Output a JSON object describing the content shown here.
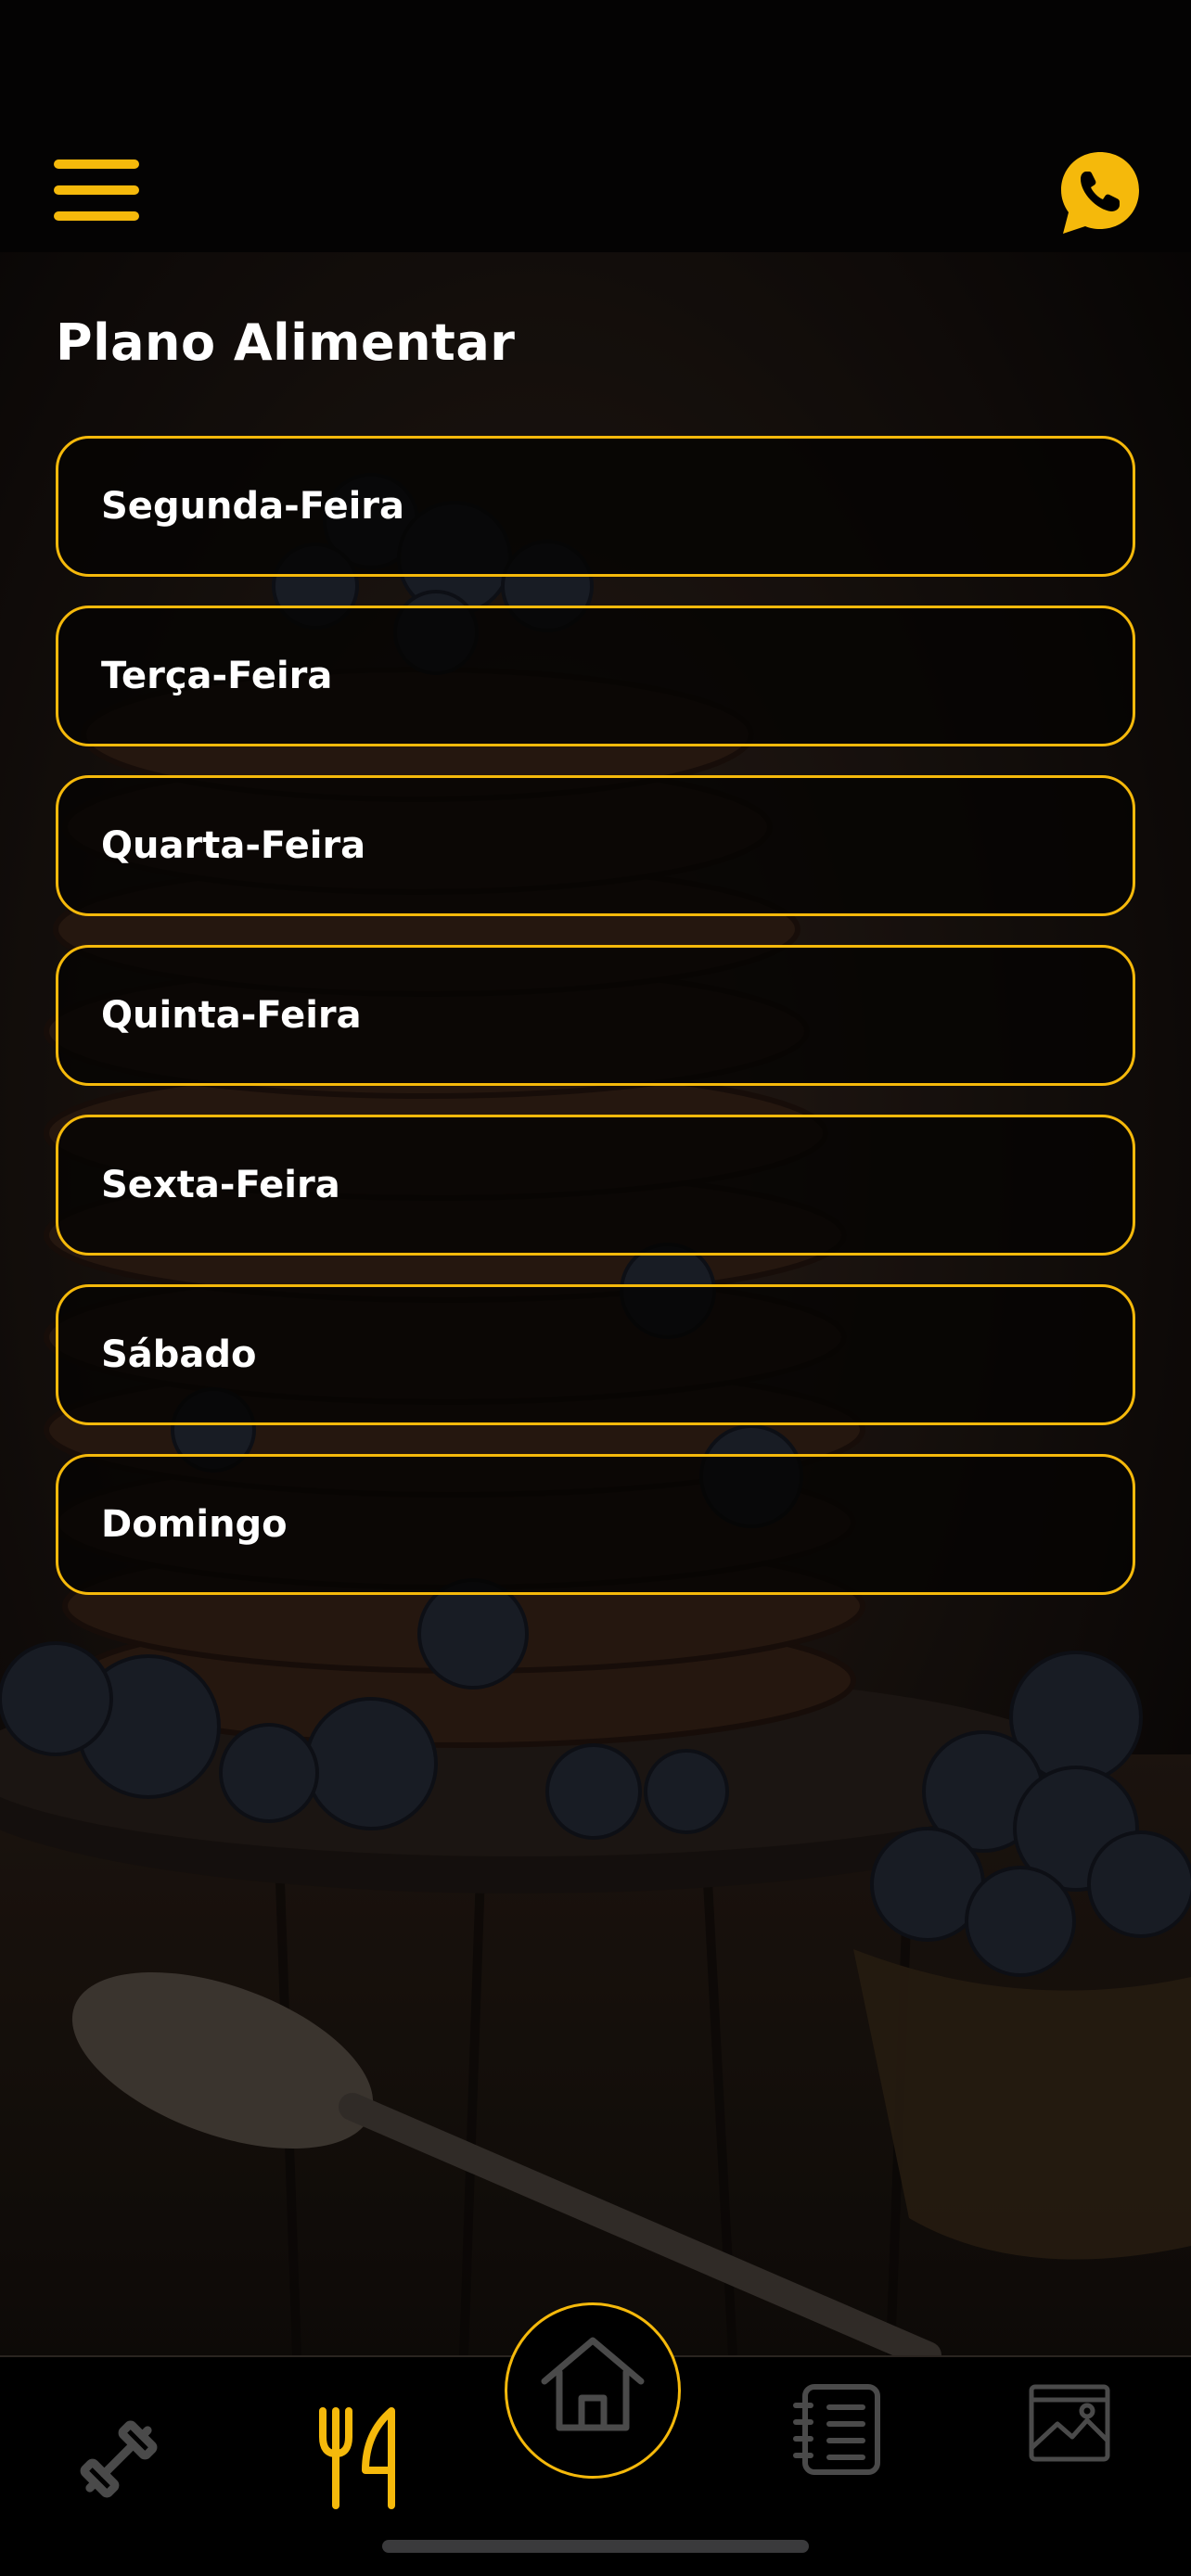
{
  "header": {
    "menu_icon": "hamburger-menu-icon",
    "contact_icon": "whatsapp-icon"
  },
  "page": {
    "title": "Plano Alimentar"
  },
  "days": [
    {
      "label": "Segunda-Feira"
    },
    {
      "label": "Terça-Feira"
    },
    {
      "label": "Quarta-Feira"
    },
    {
      "label": "Quinta-Feira"
    },
    {
      "label": "Sexta-Feira"
    },
    {
      "label": "Sábado"
    },
    {
      "label": "Domingo"
    }
  ],
  "bottom_nav": {
    "items": [
      {
        "icon": "dumbbell-icon",
        "active": false
      },
      {
        "icon": "fork-knife-icon",
        "active": true
      },
      {
        "icon": "home-icon",
        "active": false
      },
      {
        "icon": "notebook-list-icon",
        "active": false
      },
      {
        "icon": "gallery-image-icon",
        "active": false
      }
    ]
  },
  "theme": {
    "accent": "#f5b90b",
    "background": "#000000",
    "text": "#ffffff",
    "inactive_icon": "#4a4a4a"
  }
}
